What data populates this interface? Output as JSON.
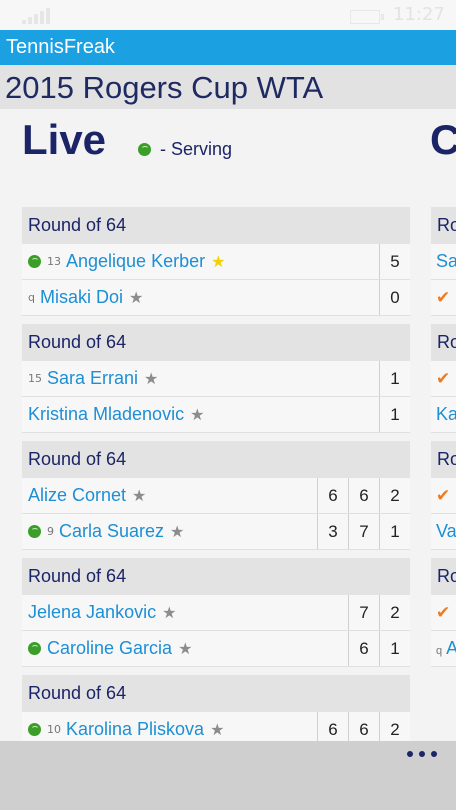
{
  "status": {
    "time": "11:27"
  },
  "app": {
    "name": "TennisFreak"
  },
  "tournament": {
    "title": "2015 Rogers Cup WTA"
  },
  "pivot": {
    "current": "Live",
    "next_peek": "C",
    "legend_label": "- Serving"
  },
  "matches": [
    {
      "round": "Round of 64",
      "players": [
        {
          "seed": "13",
          "name": "Angelique Kerber",
          "serving": true,
          "favorite": true,
          "scores": [
            "5"
          ]
        },
        {
          "seed": "q",
          "name": "Misaki Doi",
          "serving": false,
          "favorite": false,
          "scores": [
            "0"
          ]
        }
      ]
    },
    {
      "round": "Round of 64",
      "players": [
        {
          "seed": "15",
          "name": "Sara Errani",
          "serving": false,
          "favorite": false,
          "scores": [
            "1"
          ]
        },
        {
          "seed": "",
          "name": "Kristina Mladenovic",
          "serving": false,
          "favorite": false,
          "scores": [
            "1"
          ]
        }
      ]
    },
    {
      "round": "Round of 64",
      "players": [
        {
          "seed": "",
          "name": "Alize Cornet",
          "serving": false,
          "favorite": false,
          "scores": [
            "6",
            "6",
            "2"
          ]
        },
        {
          "seed": "9",
          "name": "Carla Suarez",
          "serving": true,
          "favorite": false,
          "scores": [
            "3",
            "7",
            "1"
          ]
        }
      ]
    },
    {
      "round": "Round of 64",
      "players": [
        {
          "seed": "",
          "name": "Jelena Jankovic",
          "serving": false,
          "favorite": false,
          "scores": [
            "7",
            "2"
          ]
        },
        {
          "seed": "",
          "name": "Caroline Garcia",
          "serving": true,
          "favorite": false,
          "scores": [
            "6",
            "1"
          ]
        }
      ]
    },
    {
      "round": "Round of 64",
      "players": [
        {
          "seed": "10",
          "name": "Karolina Pliskova",
          "serving": true,
          "favorite": false,
          "scores": [
            "6",
            "6",
            "2"
          ]
        }
      ]
    }
  ],
  "next_column": {
    "blocks": [
      {
        "head": "Ro",
        "rows": [
          {
            "check": false,
            "seed": "",
            "text": "Sa"
          },
          {
            "check": true,
            "seed": "",
            "text": ""
          }
        ]
      },
      {
        "head": "Ro",
        "rows": [
          {
            "check": true,
            "seed": "",
            "text": ""
          },
          {
            "check": false,
            "seed": "",
            "text": "Ka"
          }
        ]
      },
      {
        "head": "Ro",
        "rows": [
          {
            "check": true,
            "seed": "",
            "text": ""
          },
          {
            "check": false,
            "seed": "",
            "text": "Va"
          }
        ]
      },
      {
        "head": "Ro",
        "rows": [
          {
            "check": true,
            "seed": "",
            "text": ""
          },
          {
            "check": false,
            "seed": "q",
            "text": "A"
          }
        ]
      }
    ]
  },
  "colors": {
    "accent": "#1ba1e2",
    "title": "#1a2466",
    "player": "#1d8fd4",
    "serve_ball": "#3a9e28",
    "favorite_star": "#f4d200",
    "check": "#f07b1e"
  }
}
